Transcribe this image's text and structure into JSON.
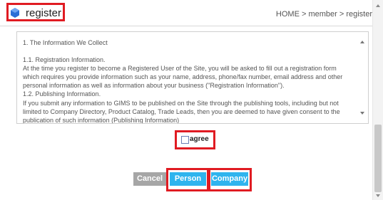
{
  "header": {
    "title": "register",
    "breadcrumb": "HOME > member > register"
  },
  "terms": {
    "lines": [
      "1. The Information We Collect",
      "",
      "1.1. Registration Information.",
      "At the time you register to become a Registered User of the Site, you will be asked to fill out a registration form",
      "which requires you provide information such as your name, address, phone/fax number, email address and other",
      "personal information as well as information about your business (\"Registration Information\").",
      "1.2. Publishing Information.",
      "If you submit any information to GIMS to be published on the Site through the publishing tools, including but not",
      "limited to Company Directory, Product Catalog, Trade Leads, then you are deemed to have given consent to the",
      "publication of such information (Publishing Information)"
    ]
  },
  "agree": {
    "label": "agree",
    "checked": false
  },
  "buttons": {
    "cancel": "Cancel",
    "person": "Person",
    "company": "Company"
  },
  "colors": {
    "highlight": "#e01b22",
    "button_blue": "#2fb4ee",
    "button_gray": "#a6a6a6",
    "logo_blue": "#2b6fd6"
  },
  "icons": {
    "logo": "blue-gem-icon"
  }
}
